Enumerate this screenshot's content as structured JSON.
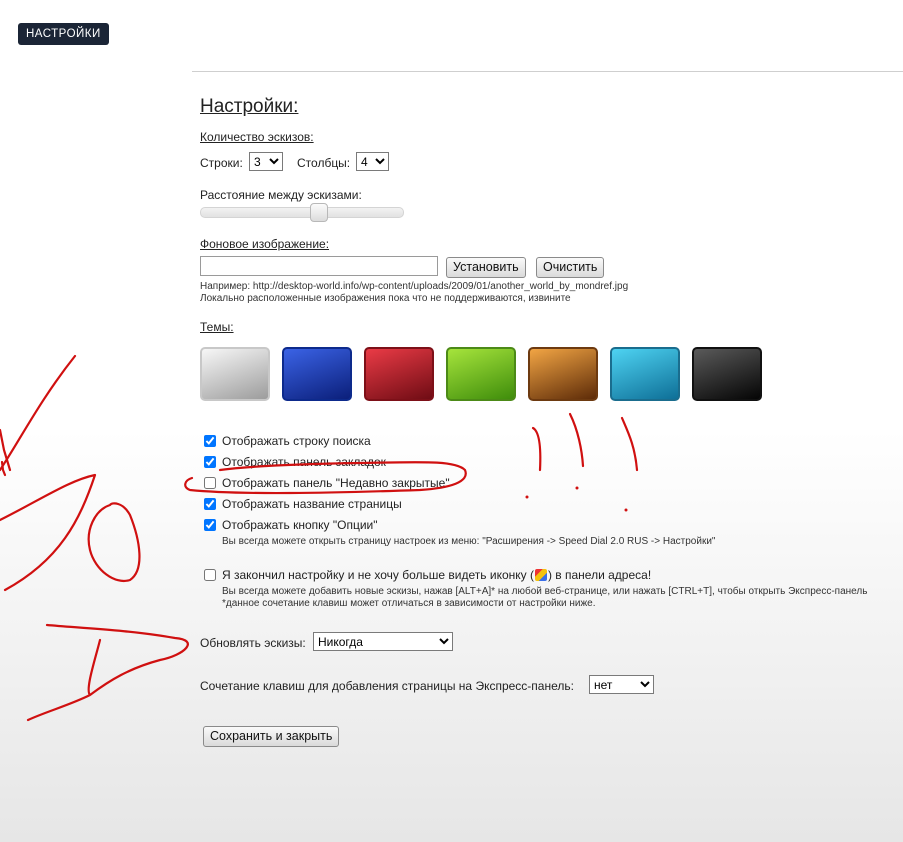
{
  "header": {
    "settings_button": "НАСТРОЙКИ"
  },
  "page": {
    "title": "Настройки:"
  },
  "thumbs": {
    "heading": "Количество эскизов:",
    "rows_label": "Строки:",
    "rows_value": "3",
    "cols_label": "Столбцы:",
    "cols_value": "4"
  },
  "spacing": {
    "label": "Расстояние между эскизами:",
    "level": 0.59
  },
  "background": {
    "heading": "Фоновое изображение:",
    "value": "",
    "set_button": "Установить",
    "clear_button": "Очистить",
    "example": "Например: http://desktop-world.info/wp-content/uploads/2009/01/another_world_by_mondref.jpg",
    "note": "Локально расположенные изображения пока что не поддерживаются, извините"
  },
  "themes": {
    "heading": "Темы:",
    "items": [
      {
        "name": "white",
        "from": "#f7f7f7",
        "to": "#9c9c9c",
        "border": "#c8c8c8"
      },
      {
        "name": "blue",
        "from": "#3b63e6",
        "to": "#0b1f7a",
        "border": "#0d2a8c"
      },
      {
        "name": "red",
        "from": "#ea3b46",
        "to": "#6f0c14",
        "border": "#7d1018"
      },
      {
        "name": "green",
        "from": "#a6e43c",
        "to": "#3f8d0b",
        "border": "#4c8a17"
      },
      {
        "name": "orange",
        "from": "#f2a544",
        "to": "#5d2b08",
        "border": "#6d3a10"
      },
      {
        "name": "cyan",
        "from": "#4ed3f2",
        "to": "#0e6f97",
        "border": "#1a6d8e"
      },
      {
        "name": "black",
        "from": "#5a5a5a",
        "to": "#050505",
        "border": "#111111"
      }
    ]
  },
  "options": {
    "show_search": {
      "label": "Отображать строку поиска",
      "checked": true
    },
    "show_bookmarks": {
      "label": "Отображать панель закладок",
      "checked": true
    },
    "show_recent": {
      "label": "Отображать панель \"Недавно закрытые\"",
      "checked": false
    },
    "show_page_title": {
      "label": "Отображать название страницы",
      "checked": true
    },
    "show_options_button": {
      "label": "Отображать кнопку \"Опции\"",
      "checked": true
    },
    "options_hint": "Вы всегда можете открыть страницу настроек из меню: \"Расширения -> Speed Dial 2.0 RUS -> Настройки\"",
    "hide_icon": {
      "label_before": "Я закончил настройку и не хочу больше видеть иконку (",
      "label_after": ") в панели адреса!",
      "checked": false
    },
    "hide_icon_hint1": "Вы всегда можете добавить новые эскизы, нажав [ALT+A]* на любой веб-странице, или нажать [CTRL+T], чтобы открыть Экспресс-панель",
    "hide_icon_hint2": "*данное сочетание клавиш может отличаться в зависимости от настройки ниже."
  },
  "refresh": {
    "label": "Обновлять эскизы:",
    "value": "Никогда"
  },
  "hotkey": {
    "label": "Сочетание клавиш для добавления страницы на Экспресс-панель:",
    "value": "нет"
  },
  "save_button": "Сохранить и закрыть",
  "colors": {
    "annotation_red": "#d01010",
    "header_button_bg": "#1b2536"
  }
}
